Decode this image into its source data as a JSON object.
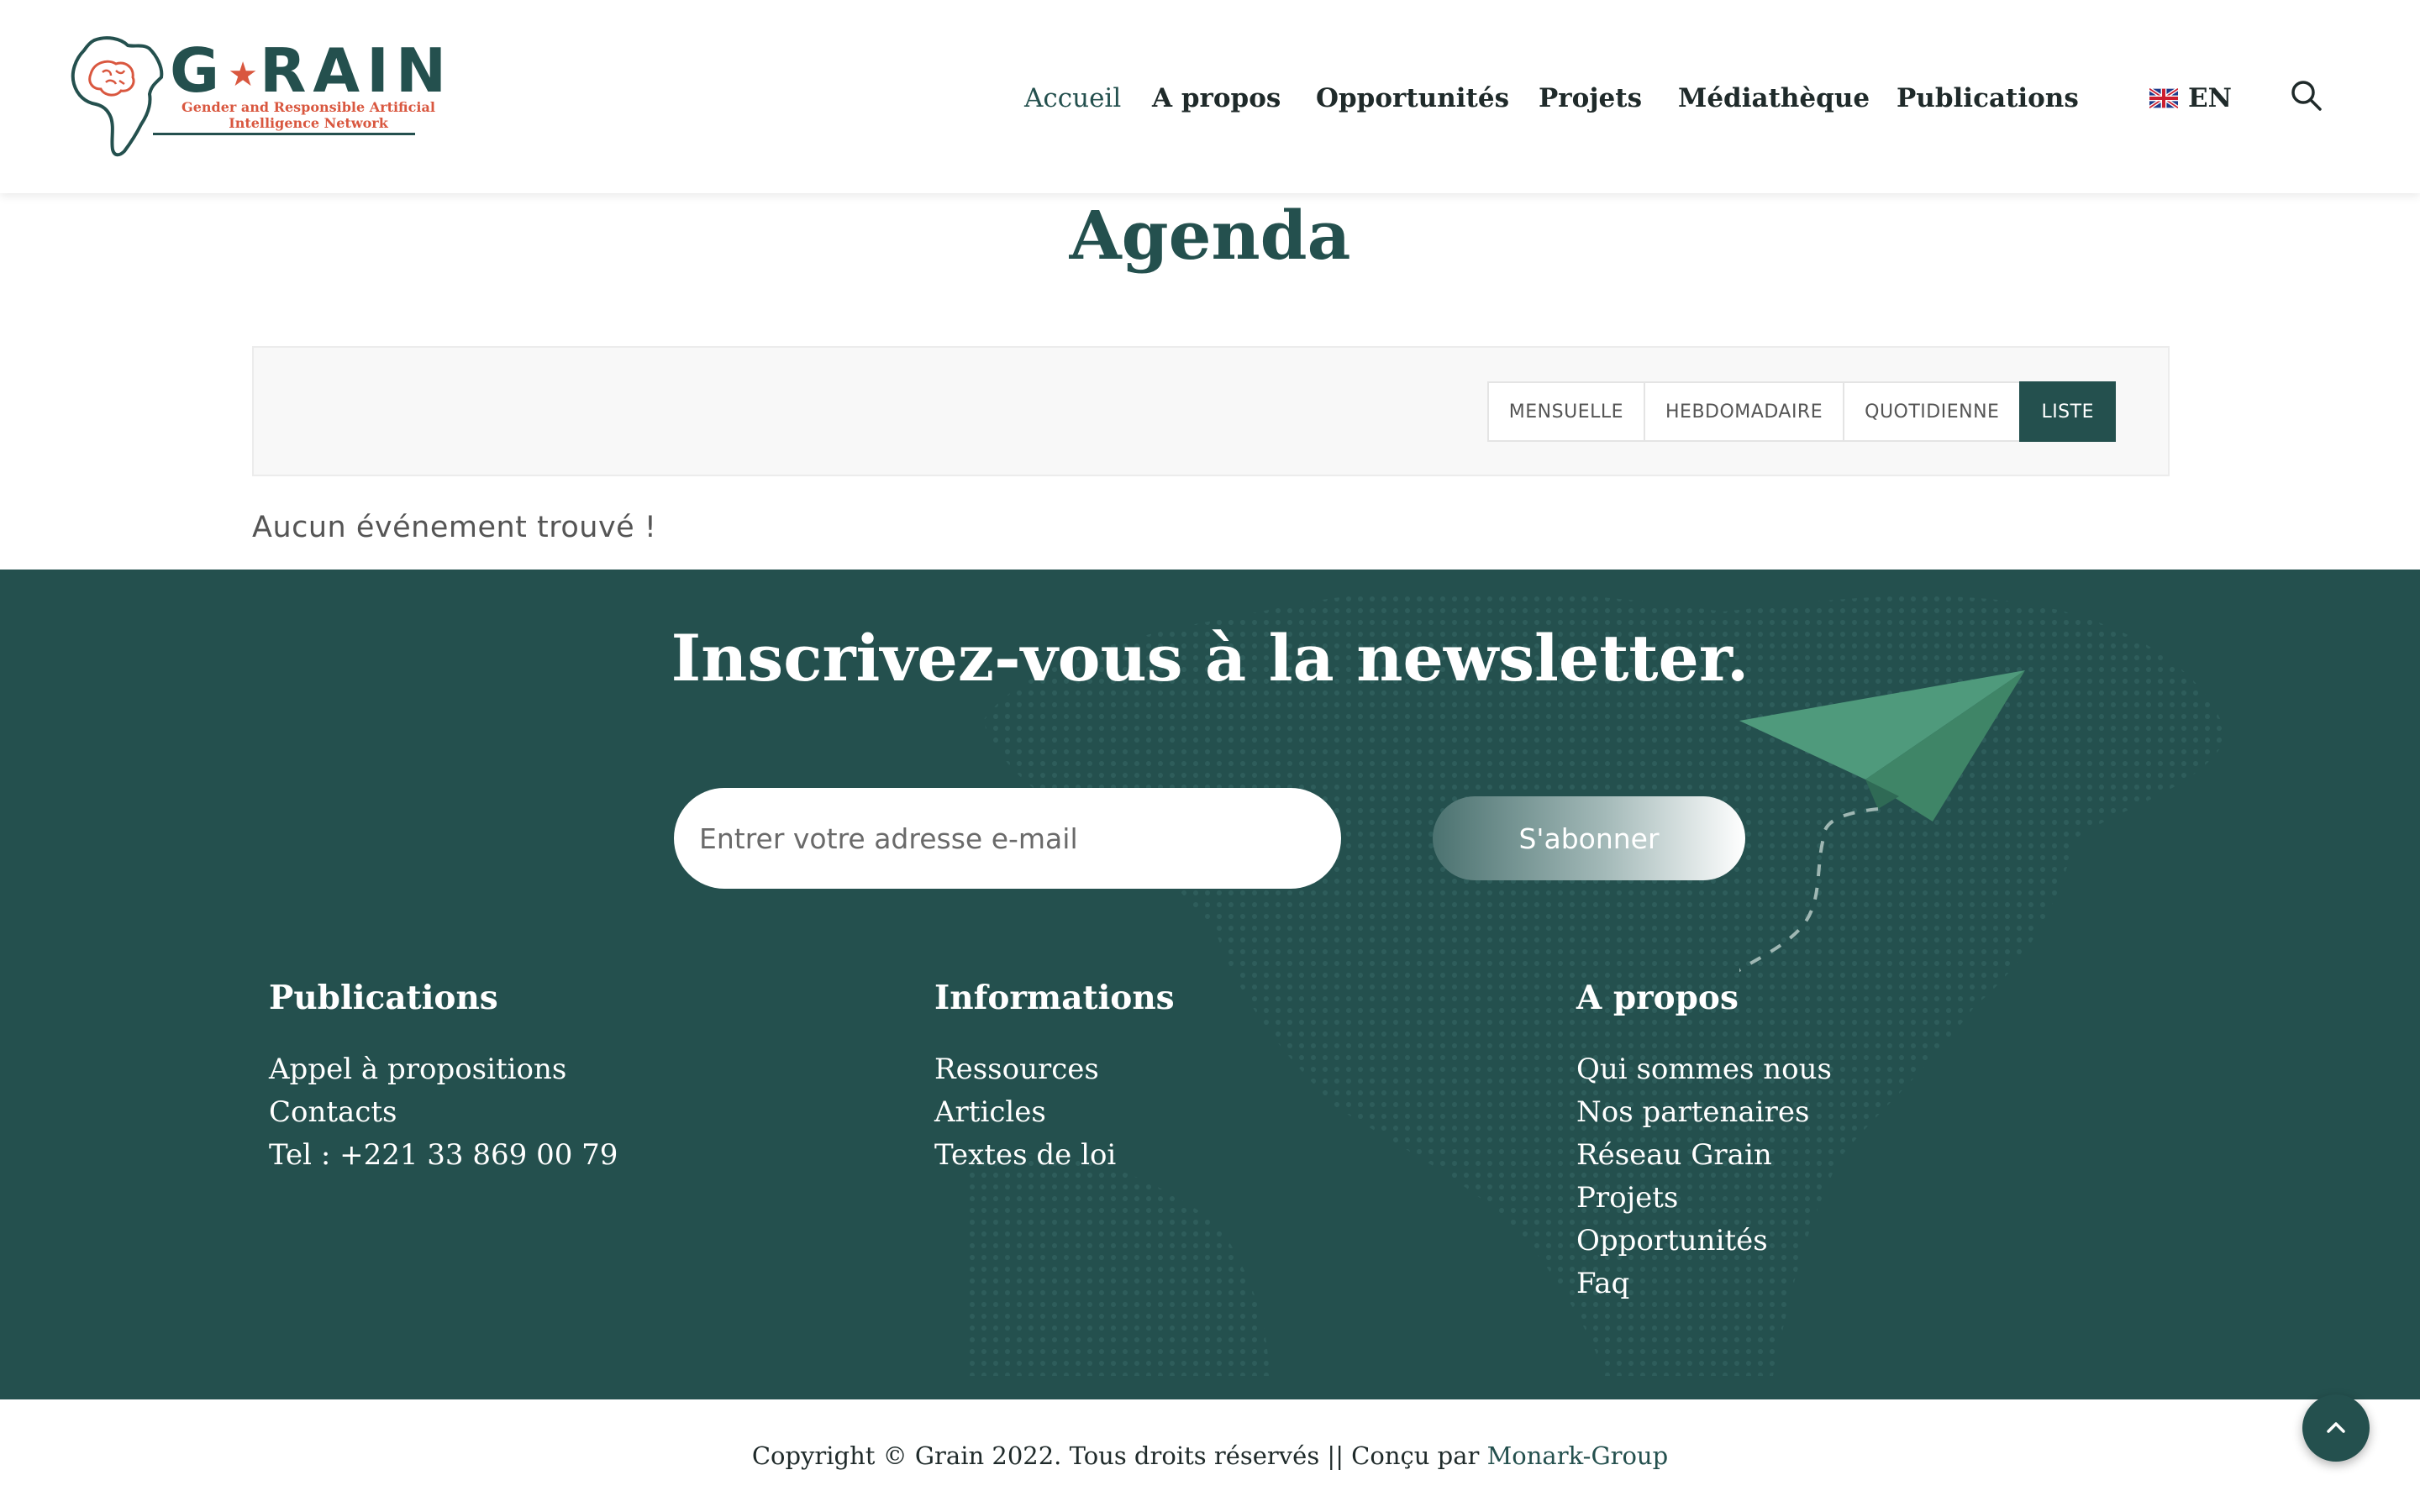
{
  "header": {
    "logo": {
      "word": "GRAIN",
      "subtitle_line1": "Gender and Responsible Artificial",
      "subtitle_line2": "Intelligence Network"
    },
    "nav": [
      {
        "label": "Accueil",
        "active": true
      },
      {
        "label": "A propos"
      },
      {
        "label": "Opportunités"
      },
      {
        "label": "Projets"
      },
      {
        "label": "Médiathèque"
      },
      {
        "label": "Publications"
      }
    ],
    "language": {
      "label": "EN",
      "icon": "uk-flag-icon"
    },
    "search_icon": "search-icon"
  },
  "agenda": {
    "title": "Agenda",
    "views": [
      {
        "label": "MENSUELLE"
      },
      {
        "label": "HEBDOMADAIRE"
      },
      {
        "label": "QUOTIDIENNE"
      },
      {
        "label": "LISTE",
        "active": true
      }
    ],
    "empty_message": "Aucun événement trouvé !"
  },
  "newsletter": {
    "title": "Inscrivez-vous à la newsletter.",
    "email_placeholder": "Entrer votre adresse e-mail",
    "subscribe_label": "S'abonner"
  },
  "footer_columns": {
    "publications": {
      "title": "Publications",
      "items": [
        "Appel à propositions",
        "Contacts",
        "Tel : +221 33 869 00 79"
      ]
    },
    "informations": {
      "title": "Informations",
      "items": [
        "Ressources",
        "Articles",
        "Textes de loi"
      ]
    },
    "apropos": {
      "title": "A propos",
      "items": [
        "Qui sommes nous",
        "Nos partenaires",
        "Réseau Grain",
        "Projets",
        "Opportunités",
        "Faq"
      ]
    }
  },
  "copyright": {
    "text": "Copyright © Grain 2022. Tous droits réservés || Conçu par ",
    "link": "Monark-Group"
  },
  "colors": {
    "brand": "#24504e",
    "accent": "#d9573f",
    "plane": "#4f9a7c"
  }
}
